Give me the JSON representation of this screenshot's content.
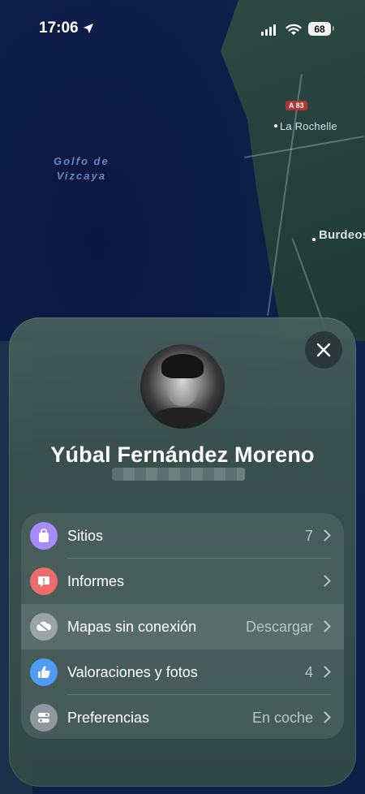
{
  "status_bar": {
    "time": "17:06",
    "battery": "68"
  },
  "map": {
    "sea_label_line1": "Golfo de",
    "sea_label_line2": "Vizcaya",
    "road_shield": "A 83",
    "city_1": "La Rochelle",
    "city_2": "Burdeos"
  },
  "profile": {
    "name": "Yúbal Fernández Moreno"
  },
  "menu": {
    "items": [
      {
        "label": "Sitios",
        "value": "7",
        "icon": "bag-icon",
        "color": "#a78bfa"
      },
      {
        "label": "Informes",
        "value": "",
        "icon": "report-icon",
        "color": "#f06a6a"
      },
      {
        "label": "Mapas sin conexión",
        "value": "Descargar",
        "icon": "offline-cloud-icon",
        "color": "#9aa3a8"
      },
      {
        "label": "Valoraciones y fotos",
        "value": "4",
        "icon": "thumbs-up-icon",
        "color": "#4f9bf5"
      },
      {
        "label": "Preferencias",
        "value": "En coche",
        "icon": "toggles-icon",
        "color": "#8f989c"
      }
    ]
  }
}
